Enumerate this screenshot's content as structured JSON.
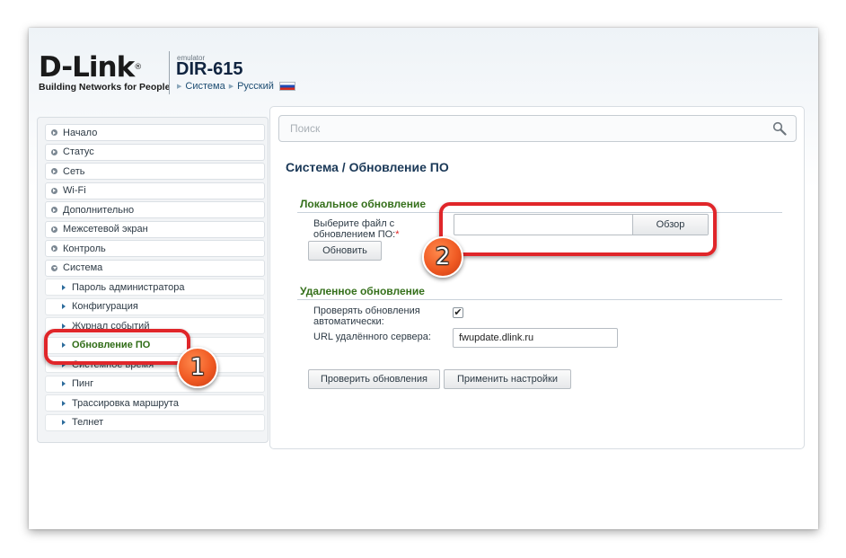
{
  "header": {
    "logo_text": "D-Link",
    "logo_reg": "®",
    "tagline": "Building Networks for People",
    "emulator_label": "emulator",
    "model": "DIR-615",
    "breadcrumb": [
      "Система",
      "Русский"
    ]
  },
  "sidebar": {
    "items": [
      {
        "label": "Начало"
      },
      {
        "label": "Статус"
      },
      {
        "label": "Сеть"
      },
      {
        "label": "Wi-Fi"
      },
      {
        "label": "Дополнительно"
      },
      {
        "label": "Межсетевой экран"
      },
      {
        "label": "Контроль"
      },
      {
        "label": "Система"
      }
    ],
    "sub_items": [
      {
        "label": "Пароль администратора"
      },
      {
        "label": "Конфигурация"
      },
      {
        "label": "Журнал событий"
      },
      {
        "label": "Обновление ПО"
      },
      {
        "label": "Системное время"
      },
      {
        "label": "Пинг"
      },
      {
        "label": "Трассировка маршрута"
      },
      {
        "label": "Телнет"
      }
    ]
  },
  "search": {
    "placeholder": "Поиск"
  },
  "main": {
    "title": "Система /  Обновление ПО",
    "local": {
      "section_title": "Локальное обновление",
      "file_label_line1": "Выберите файл с",
      "file_label_line2": "обновлением ПО:",
      "required_mark": "*",
      "browse_label": "Обзор",
      "update_label": "Обновить"
    },
    "remote": {
      "section_title": "Удаленное обновление",
      "auto_label_line1": "Проверять обновления",
      "auto_label_line2": "автоматически:",
      "auto_checked": "✔",
      "url_label": "URL удалённого сервера:",
      "url_value": "fwupdate.dlink.ru",
      "check_label": "Проверить обновления",
      "apply_label": "Применить настройки"
    }
  },
  "annotations": {
    "badge_1": "1",
    "badge_2": "2",
    "highlight_color": "#e0262a",
    "badge_color": "#f05a23"
  }
}
